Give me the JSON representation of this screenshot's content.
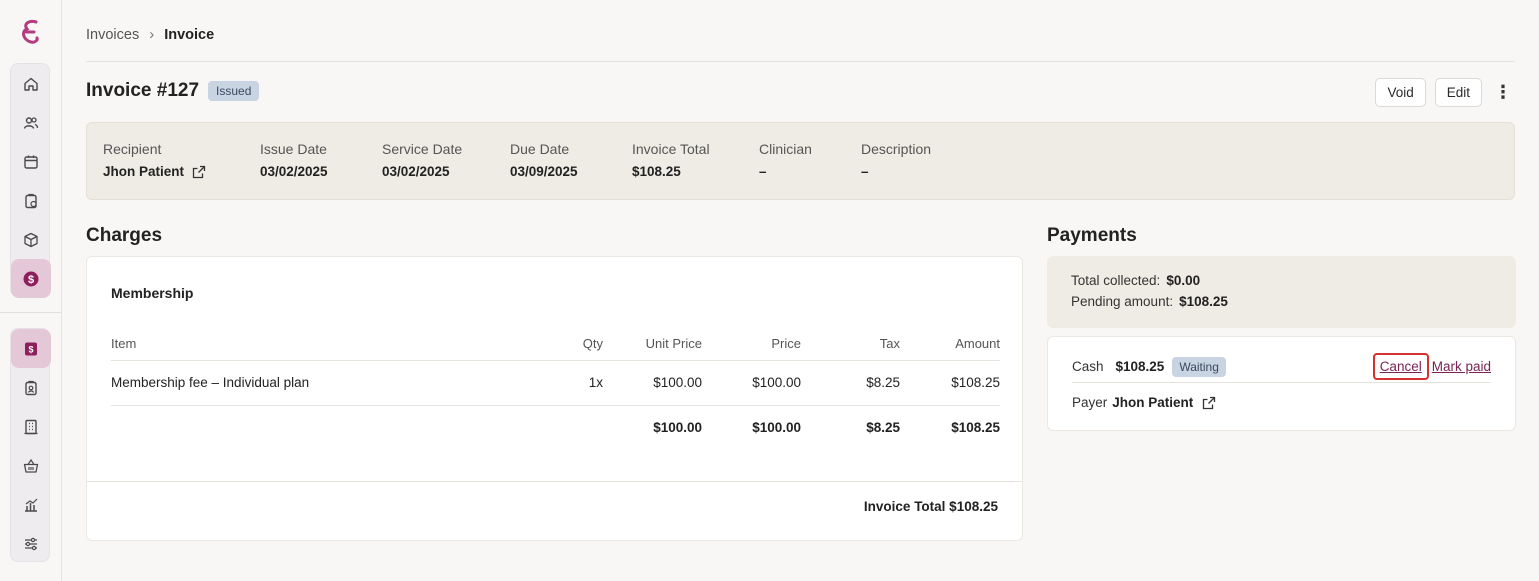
{
  "breadcrumb": {
    "parent": "Invoices",
    "current": "Invoice"
  },
  "invoice": {
    "title": "Invoice #127",
    "status": "Issued"
  },
  "actions": {
    "void_label": "Void",
    "edit_label": "Edit"
  },
  "info": {
    "recipient_label": "Recipient",
    "recipient_value": "Jhon Patient",
    "issue_label": "Issue Date",
    "issue_value": "03/02/2025",
    "service_label": "Service Date",
    "service_value": "03/02/2025",
    "due_label": "Due Date",
    "due_value": "03/09/2025",
    "total_label": "Invoice Total",
    "total_value": "$108.25",
    "clinician_label": "Clinician",
    "clinician_value": "–",
    "description_label": "Description",
    "description_value": "–"
  },
  "charges": {
    "section_title": "Charges",
    "group": "Membership",
    "headers": {
      "item": "Item",
      "qty": "Qty",
      "unit_price": "Unit Price",
      "price": "Price",
      "tax": "Tax",
      "amount": "Amount"
    },
    "rows": [
      {
        "item": "Membership fee – Individual plan",
        "qty": "1x",
        "unit_price": "$100.00",
        "price": "$100.00",
        "tax": "$8.25",
        "amount": "$108.25"
      }
    ],
    "totals": {
      "unit_price": "$100.00",
      "price": "$100.00",
      "tax": "$8.25",
      "amount": "$108.25"
    },
    "invoice_total": "Invoice Total $108.25"
  },
  "payments": {
    "section_title": "Payments",
    "collected_label": "Total collected:",
    "collected_value": "$0.00",
    "pending_label": "Pending amount:",
    "pending_value": "$108.25",
    "method": "Cash",
    "amount": "$108.25",
    "status": "Waiting",
    "cancel_label": "Cancel",
    "mark_paid_label": "Mark paid",
    "payer_label": "Payer",
    "payer_value": "Jhon Patient"
  },
  "colors": {
    "accent": "#7a2357",
    "badge_bg": "#c9d4e2",
    "focus_ring": "#d6302f",
    "panel_bg": "#efece5"
  },
  "sidebar": {
    "icons": [
      "home-icon",
      "users-icon",
      "calendar-icon",
      "clipboard-icon",
      "cube-icon",
      "dollar-icon",
      "invoice-icon",
      "badge-icon",
      "building-icon",
      "basket-icon",
      "chart-icon",
      "sliders-icon"
    ]
  }
}
